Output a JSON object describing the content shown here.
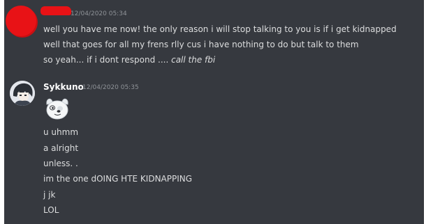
{
  "messages": [
    {
      "author": "",
      "timestamp": "12/04/2020 05:34",
      "lines": [
        "well you have me now! the only reason i will stop talking to you is if i get kidnapped",
        "well that goes for all my frens rlly cus i have nothing to do but talk to them"
      ],
      "line3_prefix": "so yeah... if i dont respond .... ",
      "line3_italic": "call the fbi"
    },
    {
      "author": "Sykkuno",
      "timestamp": "12/04/2020 05:35",
      "emoji": "cartoon-dog-emoji",
      "lines": [
        "u uhmm",
        "a alright",
        "unless. .",
        "im the one dOING HTE KIDNAPPING",
        "j jk",
        "LOL"
      ]
    }
  ],
  "colors": {
    "background": "#36393f",
    "text": "#dcddde",
    "username": "#ffffff",
    "timestamp": "#8e9297",
    "redaction": "#e81216"
  }
}
